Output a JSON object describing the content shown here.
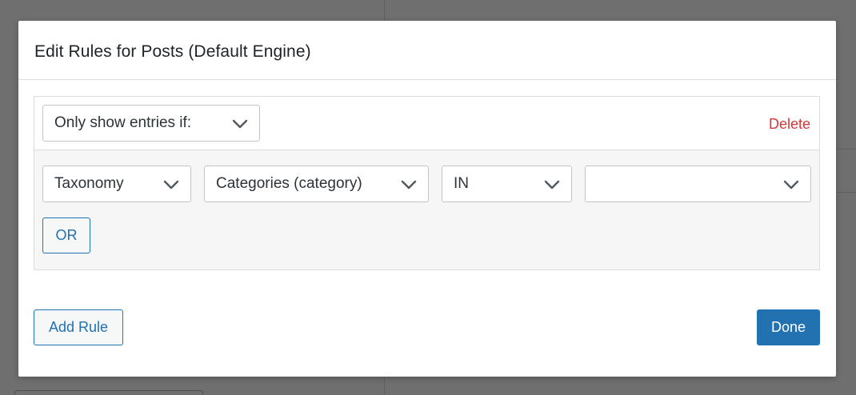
{
  "modal": {
    "title": "Edit Rules for Posts (Default Engine)",
    "rule": {
      "condition_select": "Only show entries if:",
      "delete_label": "Delete",
      "row": {
        "type_select": "Taxonomy",
        "taxonomy_select": "Categories (category)",
        "operator_select": "IN",
        "value_select": ""
      },
      "or_label": "OR"
    },
    "add_rule_label": "Add Rule",
    "done_label": "Done"
  },
  "colors": {
    "accent": "#2271b1",
    "danger": "#d63638",
    "overlay": "#6e6e6e"
  },
  "icons": {
    "dropdown": "chevron-down-icon"
  }
}
